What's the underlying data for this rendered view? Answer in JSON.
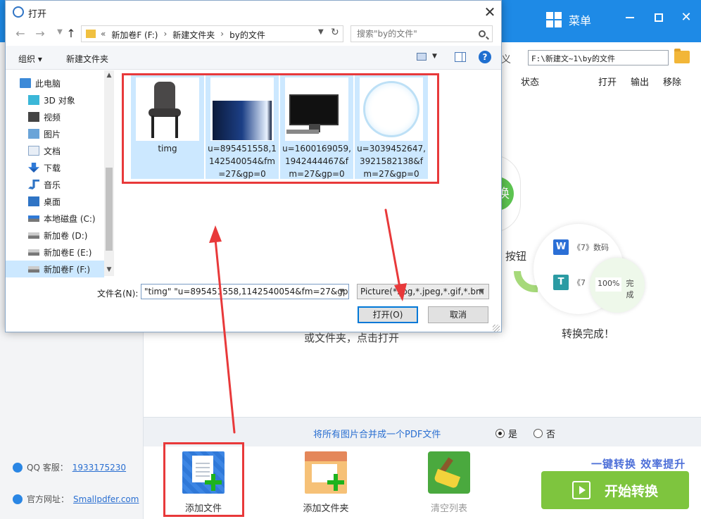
{
  "app": {
    "menu_label": "菜单",
    "path_partial": "义",
    "path_value": "F:\\新建文~1\\by的文件",
    "columns": {
      "status": "状态",
      "open": "打开",
      "output": "输出",
      "remove": "移除"
    },
    "illustration": {
      "swirl_text": "换",
      "button_text": "按钮",
      "doc_row_1": "《7》数码",
      "doc_row_2": "《7",
      "progress_value": "100%",
      "progress_label": "完成",
      "done_text": "转换完成！"
    },
    "drop_hint": "或文件夹，点击打开",
    "merge": {
      "text": "将所有图片合并成一个PDF文件",
      "yes": "是",
      "no": "否",
      "selected": "yes"
    },
    "tools": {
      "add_file": "添加文件",
      "add_folder": "添加文件夹",
      "clear_list": "清空列表"
    },
    "slogan": "一键转换  效率提升",
    "start_label": "开始转换",
    "contact": {
      "qq_label": "QQ 客服：",
      "qq_value": "1933175230",
      "site_label": "官方网址：",
      "site_value": "Smallpdfer.com"
    },
    "colors": {
      "title_bar": "#1e8ae6",
      "start_button": "#7ec53e",
      "annotation": "#e8393a",
      "selection": "#cce8ff"
    }
  },
  "dialog": {
    "title": "打开",
    "address": {
      "overflow": "«",
      "crumbs": [
        "新加卷F (F:)",
        "新建文件夹",
        "by的文件"
      ]
    },
    "search_placeholder": "搜索\"by的文件\"",
    "toolbar": {
      "organize": "组织 ▾",
      "new_folder": "新建文件夹",
      "help": "?"
    },
    "nav_items": [
      {
        "label": "此电脑",
        "icon": "computer-icon"
      },
      {
        "label": "3D 对象",
        "icon": "cube-icon"
      },
      {
        "label": "视频",
        "icon": "video-icon"
      },
      {
        "label": "图片",
        "icon": "picture-icon"
      },
      {
        "label": "文档",
        "icon": "document-icon"
      },
      {
        "label": "下载",
        "icon": "download-icon"
      },
      {
        "label": "音乐",
        "icon": "music-icon"
      },
      {
        "label": "桌面",
        "icon": "desktop-icon"
      },
      {
        "label": "本地磁盘 (C:)",
        "icon": "drive-icon"
      },
      {
        "label": "新加卷 (D:)",
        "icon": "drive-icon"
      },
      {
        "label": "新加卷E (E:)",
        "icon": "drive-icon"
      },
      {
        "label": "新加卷F (F:)",
        "icon": "drive-icon"
      }
    ],
    "files": [
      {
        "name": "timg",
        "thumb": "chair"
      },
      {
        "name": "u=895451558,1142540054&fm=27&gp=0",
        "thumb": "light-beam"
      },
      {
        "name": "u=1600169059,1942444467&fm=27&gp=0",
        "thumb": "monitor"
      },
      {
        "name": "u=3039452647,3921582138&fm=27&gp=0",
        "thumb": "ring"
      }
    ],
    "filename_label": "文件名(N):",
    "filename_value": "\"timg\" \"u=895451558,1142540054&fm=27&gp",
    "filetype_value": "Picture(*.jpg,*.jpeg,*.gif,*.bm",
    "open_button": "打开(O)",
    "cancel_button": "取消"
  }
}
